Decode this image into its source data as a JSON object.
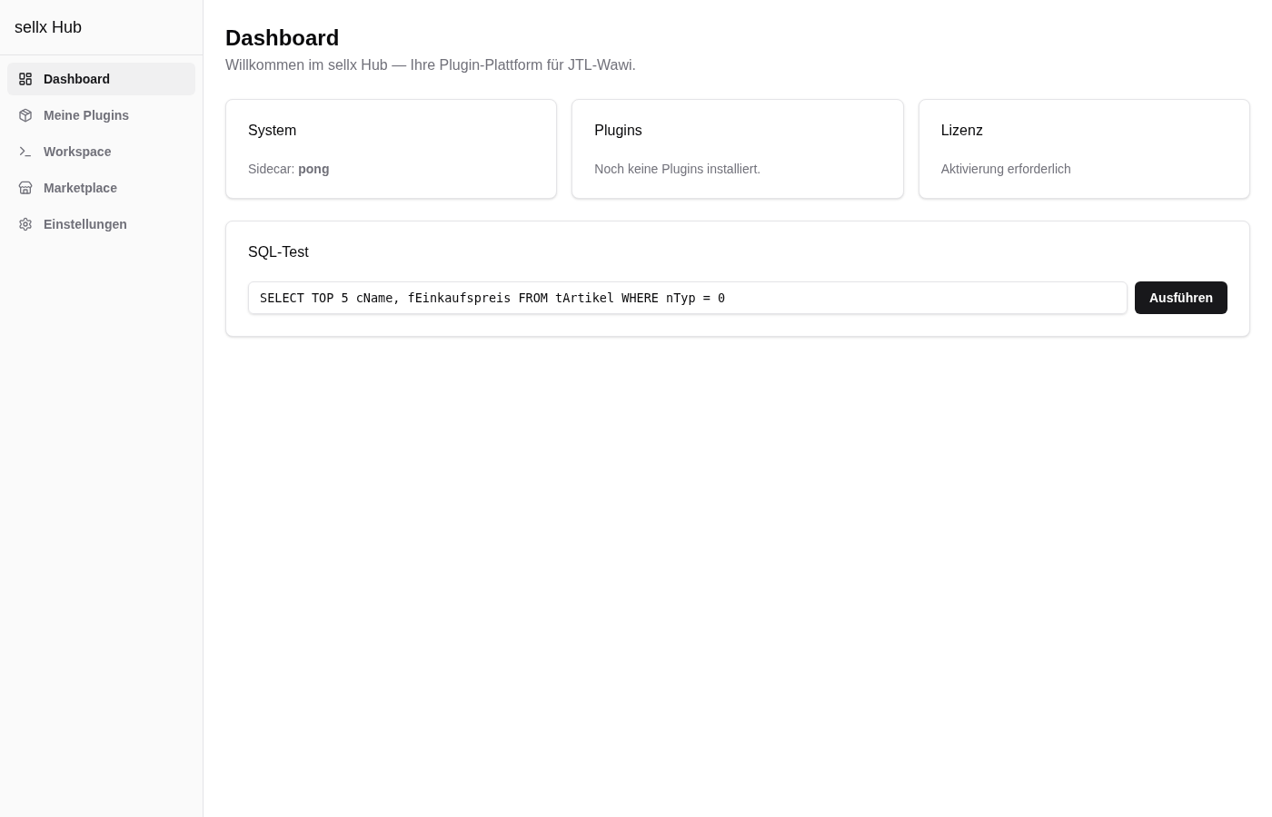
{
  "sidebar": {
    "title": "sellx Hub",
    "items": [
      {
        "label": "Dashboard",
        "selected": true
      },
      {
        "label": "Meine Plugins",
        "selected": false
      },
      {
        "label": "Workspace",
        "selected": false
      },
      {
        "label": "Marketplace",
        "selected": false
      },
      {
        "label": "Einstellungen",
        "selected": false
      }
    ]
  },
  "header": {
    "title": "Dashboard",
    "subtitle": "Willkommen im sellx Hub — Ihre Plugin-Plattform für JTL-Wawi."
  },
  "cards": [
    {
      "title": "System",
      "text": "Sidecar: **pong**"
    },
    {
      "title": "Plugins",
      "text": "Noch keine Plugins installiert."
    },
    {
      "title": "Lizenz",
      "text": "Aktivierung erforderlich"
    }
  ],
  "sql_test": {
    "title": "SQL-Test",
    "value": "SELECT TOP 5 cName, fEinkaufspreis FROM tArtikel WHERE nTyp = 0",
    "button": "Ausführen"
  }
}
